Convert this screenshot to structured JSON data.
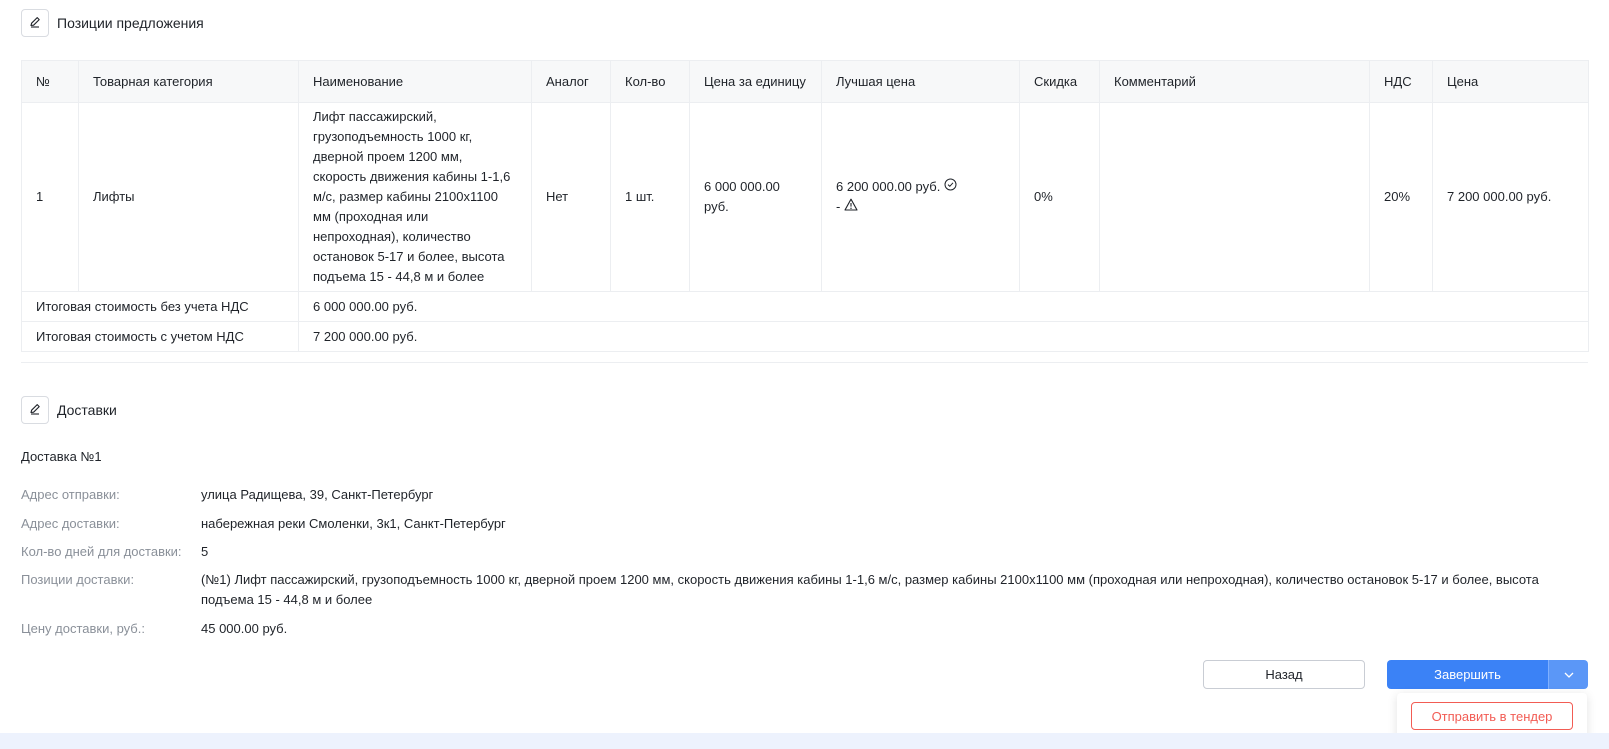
{
  "positions_section": {
    "title": "Позиции предложения",
    "icon": "pencil-icon"
  },
  "table": {
    "headers": [
      "№",
      "Товарная категория",
      "Наименование",
      "Аналог",
      "Кол-во",
      "Цена за единицу",
      "Лучшая цена",
      "Скидка",
      "Комментарий",
      "НДС",
      "Цена"
    ],
    "row": {
      "num": "1",
      "category": "Лифты",
      "name": "Лифт пассажирский, грузоподъемность 1000 кг, дверной проем 1200 мм, скорость движения кабины 1-1,6 м/с, размер кабины 2100х1100 мм (проходная или непроходная), количество остановок 5-17 и более, высота подъема 15 - 44,8 м и более",
      "analog": "Нет",
      "qty": "1 шт.",
      "unit_price": "6 000 000.00 руб.",
      "best_price": "6 200 000.00 руб.",
      "best_price_second": "-",
      "discount": "0%",
      "comment": "",
      "vat": "20%",
      "price": "7 200 000.00 руб."
    },
    "totals": [
      {
        "label": "Итоговая стоимость без учета НДС",
        "value": "6 000 000.00 руб."
      },
      {
        "label": "Итоговая стоимость с учетом НДС",
        "value": "7 200 000.00 руб."
      }
    ]
  },
  "delivery_section": {
    "title": "Доставки",
    "icon": "pencil-icon",
    "delivery_title": "Доставка №1",
    "rows": [
      {
        "label": "Адрес отправки:",
        "value": "улица Радищева, 39, Санкт-Петербург"
      },
      {
        "label": "Адрес доставки:",
        "value": "набережная реки Смоленки, 3к1, Санкт-Петербург"
      },
      {
        "label": "Кол-во дней для доставки:",
        "value": "5"
      },
      {
        "label": "Позиции доставки:",
        "value": "(№1) Лифт пассажирский, грузоподъемность 1000 кг, дверной проем 1200 мм, скорость движения кабины 1-1,6 м/с, размер кабины 2100х1100 мм (проходная или непроходная), количество остановок 5-17 и более, высота подъема 15 - 44,8 м и более"
      },
      {
        "label": "Цену доставки, руб.:",
        "value": "45 000.00 руб."
      }
    ]
  },
  "actions": {
    "back_label": "Назад",
    "finish_label": "Завершить",
    "dropdown_item": "Отправить в тендер"
  },
  "colors": {
    "primary": "#3b82f6",
    "danger": "#f25c54",
    "muted": "#8a9099"
  }
}
